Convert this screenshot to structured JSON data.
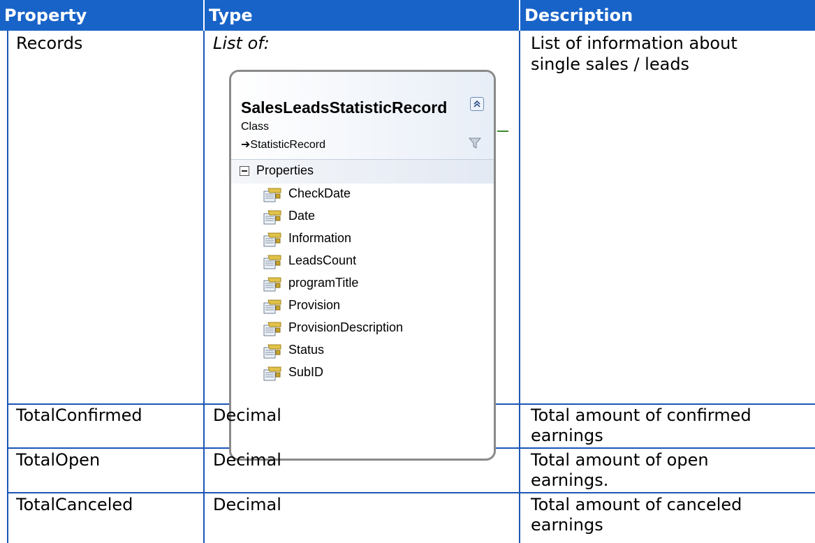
{
  "headers": {
    "property": "Property",
    "type": "Type",
    "description": "Description"
  },
  "rows": [
    {
      "property": "Records",
      "type": "List of:",
      "description_line1": "List of information about",
      "description_line2": "single sales / leads"
    },
    {
      "property": "TotalConfirmed",
      "type": "Decimal",
      "description_line1": "Total amount of confirmed",
      "description_line2": "earnings"
    },
    {
      "property": "TotalOpen",
      "type": "Decimal",
      "description_line1": "Total amount of open",
      "description_line2": "earnings."
    },
    {
      "property": "TotalCanceled",
      "type": "Decimal",
      "description_line1": "Total amount of canceled",
      "description_line2": "earnings"
    }
  ],
  "class_diagram": {
    "name": "SalesLeadsStatisticRecord",
    "kind": "Class",
    "base": "➔StatisticRecord",
    "section_label": "Properties",
    "properties": [
      "CheckDate",
      "Date",
      "Information",
      "LeadsCount",
      "programTitle",
      "Provision",
      "ProvisionDescription",
      "Status",
      "SubID"
    ]
  }
}
